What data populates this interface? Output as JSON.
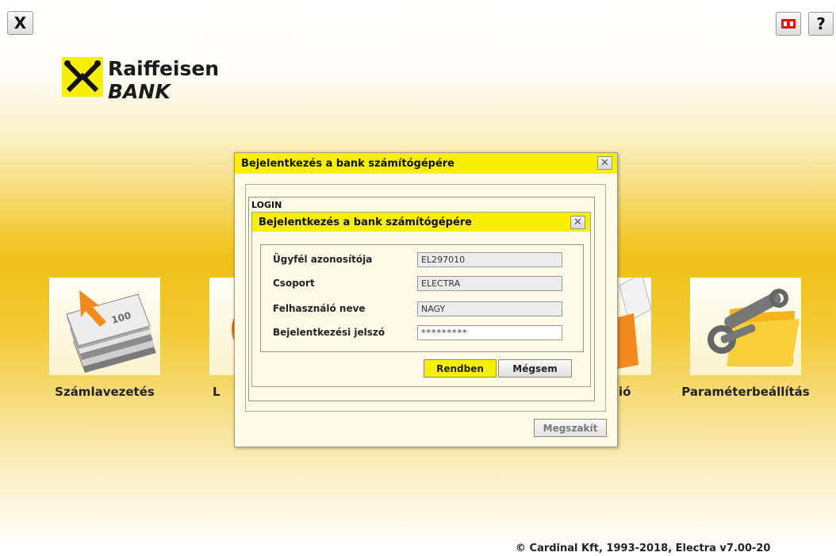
{
  "app": {
    "close_glyph": "X",
    "help_glyph": "?",
    "logo_line1": "Raiffeisen",
    "logo_line2": "BANK"
  },
  "tiles": [
    {
      "label": "Számlavezetés",
      "icon": "money-transfer-icon"
    },
    {
      "label": "L",
      "icon": "partially-hidden-icon"
    },
    {
      "label": "ió",
      "icon": "folder-documents-icon"
    },
    {
      "label": "Paraméterbeállítás",
      "icon": "folder-tools-icon"
    }
  ],
  "outer_dialog": {
    "title": "Bejelentkezés a bank számítógépére",
    "abort_label": "Megszakít"
  },
  "login": {
    "section_label": "LOGIN",
    "title": "Bejelentkezés a bank számítógépére",
    "fields": [
      {
        "label": "Ügyfél azonosítója",
        "value": "EL297010"
      },
      {
        "label": "Csoport",
        "value": "ELECTRA"
      },
      {
        "label": "Felhasználó neve",
        "value": "NAGY"
      },
      {
        "label": "Bejelentkezési jelszó",
        "value": "*********"
      }
    ],
    "ok_label": "Rendben",
    "cancel_label": "Mégsem"
  },
  "footer": "© Cardinal Kft, 1993-2018, Electra v7.00-20",
  "colors": {
    "accent_yellow": "#f8ef04",
    "background_gold": "#f0c01a",
    "arrow_orange": "#f28a1e"
  }
}
